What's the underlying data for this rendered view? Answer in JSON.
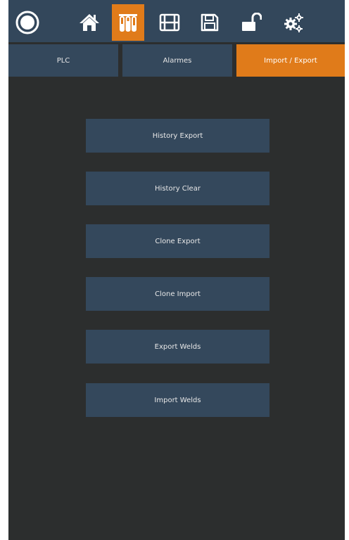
{
  "toolbar": {
    "items": [
      {
        "icon": "record-circle-icon",
        "active": false
      },
      {
        "icon": "home-icon",
        "active": false
      },
      {
        "icon": "vials-icon",
        "active": true
      },
      {
        "icon": "film-icon",
        "active": false
      },
      {
        "icon": "save-icon",
        "active": false
      },
      {
        "icon": "unlock-icon",
        "active": false
      },
      {
        "icon": "gears-icon",
        "active": false
      }
    ]
  },
  "tabs": [
    {
      "label": "PLC",
      "active": false
    },
    {
      "label": "Alarmes",
      "active": false
    },
    {
      "label": "Import / Export",
      "active": true
    }
  ],
  "actions": [
    {
      "label": "History Export"
    },
    {
      "label": "History Clear"
    },
    {
      "label": "Clone Export"
    },
    {
      "label": "Clone Import"
    },
    {
      "label": "Export Welds"
    },
    {
      "label": "Import Welds"
    }
  ],
  "colors": {
    "background": "#2c2e2e",
    "button": "#34485c",
    "accent": "#e07b1a",
    "text": "#e6e6e6"
  }
}
